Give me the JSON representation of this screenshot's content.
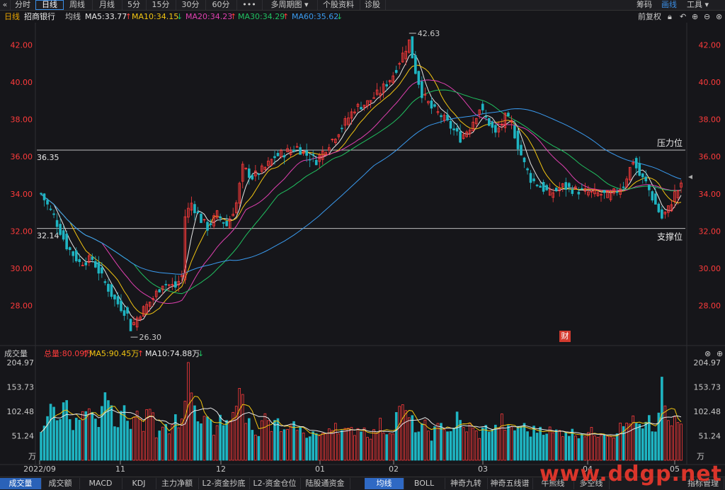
{
  "toolbar": {
    "back_icon": "back-chevron-icon",
    "tabs": [
      {
        "label": "分时",
        "active": false
      },
      {
        "label": "日线",
        "active": true
      },
      {
        "label": "周线",
        "active": false
      },
      {
        "label": "月线",
        "active": false
      },
      {
        "label": "5分",
        "active": false
      },
      {
        "label": "15分",
        "active": false
      },
      {
        "label": "30分",
        "active": false
      },
      {
        "label": "60分",
        "active": false
      },
      {
        "label": "•••",
        "active": false
      },
      {
        "label": "多周期图 ▾",
        "active": false
      },
      {
        "label": "个股资料",
        "active": false
      },
      {
        "label": "诊股",
        "active": false
      }
    ],
    "right": [
      {
        "label": "筹码",
        "active": false
      },
      {
        "label": "画线",
        "active": true
      },
      {
        "label": "工具 ▾",
        "active": false
      }
    ]
  },
  "chart_header": {
    "period": "日线",
    "stock": "招商银行",
    "ma_label": "均线",
    "ma": [
      {
        "text": "MA5:33.77",
        "arrow": "↑",
        "color": "#e8e8e8",
        "arrow_color": "#ff3b3b"
      },
      {
        "text": "MA10:34.15",
        "arrow": "↓",
        "color": "#f2c511",
        "arrow_color": "#20c060"
      },
      {
        "text": "MA20:34.23",
        "arrow": "↑",
        "color": "#e040b0",
        "arrow_color": "#ff3b3b"
      },
      {
        "text": "MA30:34.29",
        "arrow": "↑",
        "color": "#20c060",
        "arrow_color": "#ff3b3b"
      },
      {
        "text": "MA60:35.62",
        "arrow": "↓",
        "color": "#3a9bf0",
        "arrow_color": "#20c060"
      }
    ],
    "adjust": "前复权",
    "icons": [
      "lock-icon",
      "undo-icon",
      "zoom-in-icon",
      "zoom-out-icon",
      "close-icon"
    ]
  },
  "volume_header": {
    "title": "成交量",
    "total": "总量:80.09万",
    "total_arrow": "↑",
    "ma5": "MA5:90.45万",
    "ma5_arrow": "↑",
    "ma10": "MA10:74.88万",
    "ma10_arrow": "↓"
  },
  "annotations": {
    "resistance": "压力位",
    "support": "支撑位",
    "resistance_value": "36.35",
    "support_value": "32.14",
    "high_label": "42.63",
    "low_label": "26.30",
    "cai_badge": "财"
  },
  "bottom_tabs": [
    {
      "label": "成交量",
      "active": true
    },
    {
      "label": "成交额",
      "active": false
    },
    {
      "label": "MACD",
      "active": false
    },
    {
      "label": "KDJ",
      "active": false
    },
    {
      "label": "主力净额",
      "active": false
    },
    {
      "label": "L2-资金抄底",
      "active": false
    },
    {
      "label": "L2-资金仓位",
      "active": false
    },
    {
      "label": "陆股通资金",
      "active": false
    }
  ],
  "bottom_tabs_right": [
    {
      "label": "均线",
      "active": true
    },
    {
      "label": "BOLL",
      "active": false
    },
    {
      "label": "神奇九转",
      "active": false
    },
    {
      "label": "神奇五线谱",
      "active": false
    },
    {
      "label": "牛熊线",
      "active": false
    },
    {
      "label": "多空线",
      "active": false
    },
    {
      "label": "指标管理",
      "active": false
    }
  ],
  "watermark": "www.ddgp.net",
  "chart_data": {
    "type": "candlestick",
    "price_axis": {
      "ticks": [
        "42.00",
        "40.00",
        "38.00",
        "36.00",
        "34.00",
        "32.00",
        "30.00",
        "28.00"
      ],
      "range": [
        26.0,
        43.2
      ]
    },
    "volume_axis": {
      "ticks": [
        "204.97",
        "153.73",
        "102.48",
        "51.24"
      ],
      "unit": "万",
      "range": [
        0,
        204.97
      ]
    },
    "x_labels": [
      "2022/09",
      "11",
      "12",
      "01",
      "02",
      "03",
      "04",
      "05"
    ],
    "horizontal_levels": [
      {
        "label": "压力位",
        "value": 36.35
      },
      {
        "label": "支撑位",
        "value": 32.14
      }
    ],
    "extremes": {
      "high": 42.63,
      "low": 26.3
    },
    "price_anchors": [
      [
        0,
        34.0
      ],
      [
        4,
        32.8
      ],
      [
        8,
        31.2
      ],
      [
        12,
        30.3
      ],
      [
        16,
        30.5
      ],
      [
        20,
        29.2
      ],
      [
        23,
        28.3
      ],
      [
        27,
        27.5
      ],
      [
        28,
        26.8
      ],
      [
        31,
        27.6
      ],
      [
        35,
        28.4
      ],
      [
        38,
        29.2
      ],
      [
        42,
        29.0
      ],
      [
        44,
        29.6
      ],
      [
        45,
        32.8
      ],
      [
        47,
        33.5
      ],
      [
        50,
        32.6
      ],
      [
        52,
        32.2
      ],
      [
        55,
        32.9
      ],
      [
        58,
        32.3
      ],
      [
        61,
        33.5
      ],
      [
        63,
        35.4
      ],
      [
        66,
        34.9
      ],
      [
        70,
        35.4
      ],
      [
        73,
        36.0
      ],
      [
        76,
        36.2
      ],
      [
        80,
        36.5
      ],
      [
        83,
        36.1
      ],
      [
        86,
        35.8
      ],
      [
        90,
        36.7
      ],
      [
        94,
        37.6
      ],
      [
        98,
        38.6
      ],
      [
        102,
        38.9
      ],
      [
        106,
        39.5
      ],
      [
        110,
        40.4
      ],
      [
        113,
        41.5
      ],
      [
        115,
        42.2
      ],
      [
        117,
        40.6
      ],
      [
        119,
        39.4
      ],
      [
        122,
        38.6
      ],
      [
        125,
        38.2
      ],
      [
        128,
        37.6
      ],
      [
        131,
        37.0
      ],
      [
        134,
        37.6
      ],
      [
        137,
        38.6
      ],
      [
        140,
        37.8
      ],
      [
        142,
        37.2
      ],
      [
        145,
        38.1
      ],
      [
        147,
        37.8
      ],
      [
        149,
        36.6
      ],
      [
        151,
        35.6
      ],
      [
        153,
        34.8
      ],
      [
        156,
        34.4
      ],
      [
        159,
        34.0
      ],
      [
        163,
        34.4
      ],
      [
        167,
        34.2
      ],
      [
        170,
        34.1
      ],
      [
        174,
        34.0
      ],
      [
        178,
        33.9
      ],
      [
        182,
        34.5
      ],
      [
        185,
        35.8
      ],
      [
        187,
        35.0
      ],
      [
        189,
        34.6
      ],
      [
        191,
        33.8
      ],
      [
        194,
        32.7
      ],
      [
        196,
        33.2
      ],
      [
        198,
        34.0
      ],
      [
        200,
        34.4
      ]
    ],
    "volume_anchors": [
      [
        0,
        60
      ],
      [
        3,
        120
      ],
      [
        5,
        80
      ],
      [
        8,
        130
      ],
      [
        10,
        70
      ],
      [
        12,
        85
      ],
      [
        14,
        100
      ],
      [
        16,
        90
      ],
      [
        18,
        60
      ],
      [
        20,
        150
      ],
      [
        22,
        100
      ],
      [
        24,
        70
      ],
      [
        26,
        110
      ],
      [
        28,
        80
      ],
      [
        30,
        95
      ],
      [
        32,
        70
      ],
      [
        34,
        115
      ],
      [
        36,
        60
      ],
      [
        38,
        80
      ],
      [
        40,
        70
      ],
      [
        42,
        90
      ],
      [
        44,
        75
      ],
      [
        46,
        200
      ],
      [
        48,
        100
      ],
      [
        50,
        70
      ],
      [
        52,
        90
      ],
      [
        54,
        60
      ],
      [
        56,
        80
      ],
      [
        58,
        70
      ],
      [
        60,
        90
      ],
      [
        62,
        165
      ],
      [
        64,
        85
      ],
      [
        66,
        75
      ],
      [
        68,
        60
      ],
      [
        70,
        90
      ],
      [
        72,
        65
      ],
      [
        74,
        80
      ],
      [
        76,
        55
      ],
      [
        78,
        60
      ],
      [
        80,
        75
      ],
      [
        82,
        50
      ],
      [
        84,
        60
      ],
      [
        86,
        55
      ],
      [
        88,
        45
      ],
      [
        90,
        70
      ],
      [
        92,
        80
      ],
      [
        94,
        60
      ],
      [
        96,
        55
      ],
      [
        98,
        65
      ],
      [
        100,
        70
      ],
      [
        102,
        60
      ],
      [
        104,
        55
      ],
      [
        106,
        75
      ],
      [
        108,
        60
      ],
      [
        110,
        70
      ],
      [
        112,
        120
      ],
      [
        114,
        95
      ],
      [
        116,
        80
      ],
      [
        118,
        60
      ],
      [
        120,
        70
      ],
      [
        122,
        55
      ],
      [
        124,
        65
      ],
      [
        126,
        75
      ],
      [
        128,
        60
      ],
      [
        130,
        90
      ],
      [
        132,
        65
      ],
      [
        134,
        70
      ],
      [
        136,
        55
      ],
      [
        138,
        60
      ],
      [
        140,
        70
      ],
      [
        142,
        65
      ],
      [
        144,
        85
      ],
      [
        146,
        60
      ],
      [
        148,
        65
      ],
      [
        150,
        75
      ],
      [
        152,
        60
      ],
      [
        154,
        60
      ],
      [
        156,
        70
      ],
      [
        158,
        65
      ],
      [
        160,
        55
      ],
      [
        162,
        60
      ],
      [
        164,
        65
      ],
      [
        166,
        55
      ],
      [
        168,
        60
      ],
      [
        170,
        60
      ],
      [
        172,
        55
      ],
      [
        174,
        60
      ],
      [
        176,
        65
      ],
      [
        178,
        55
      ],
      [
        180,
        65
      ],
      [
        182,
        70
      ],
      [
        184,
        85
      ],
      [
        186,
        75
      ],
      [
        188,
        60
      ],
      [
        190,
        80
      ],
      [
        192,
        55
      ],
      [
        194,
        160
      ],
      [
        196,
        70
      ],
      [
        198,
        85
      ],
      [
        200,
        70
      ]
    ]
  }
}
